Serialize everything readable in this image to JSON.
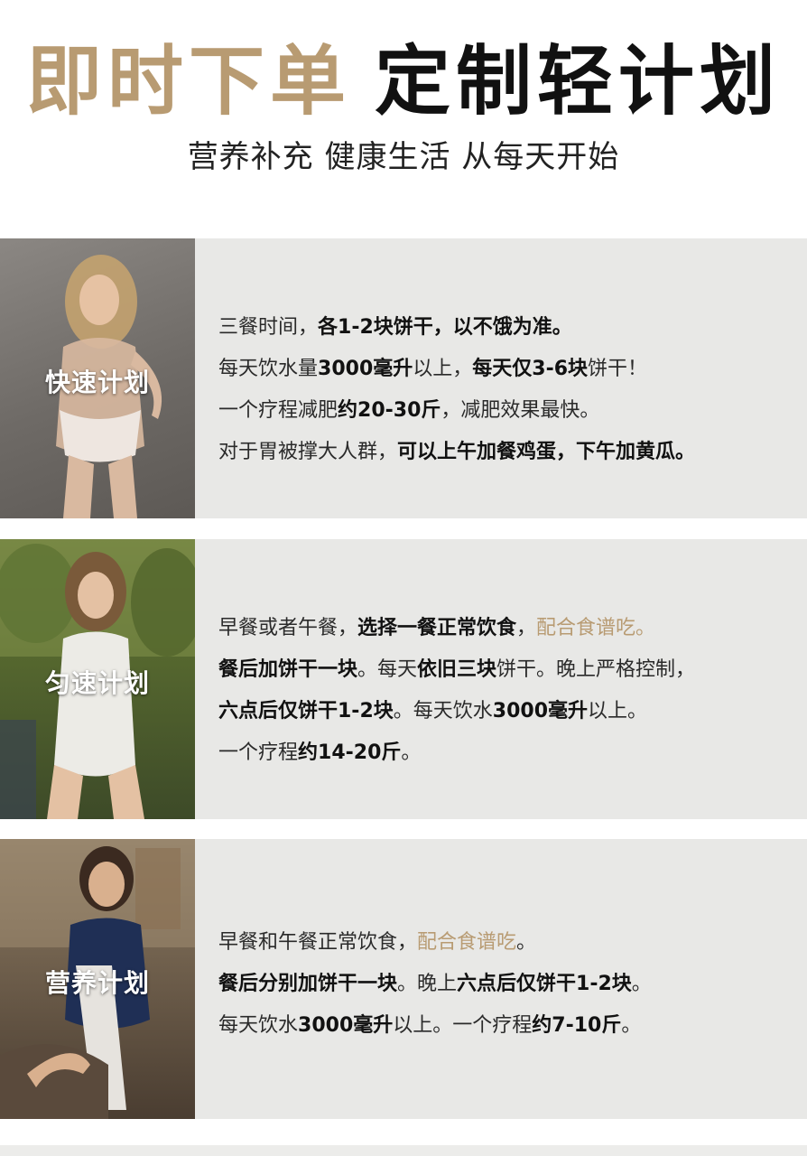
{
  "header": {
    "title_gold": "即时下单",
    "title_black": "定制轻计划",
    "subtitle": "营养补充 健康生活 从每天开始"
  },
  "colors": {
    "accent": "#b89b72",
    "panel": "#e8e8e6",
    "text": "#2a2a2a"
  },
  "plans": [
    {
      "label": "快速计划",
      "lines": [
        [
          {
            "t": "三餐时间，"
          },
          {
            "t": "各1-2块饼干，以不饿为准。",
            "b": true
          }
        ],
        [
          {
            "t": "每天饮水量"
          },
          {
            "t": "3000毫升",
            "b": true
          },
          {
            "t": "以上，"
          },
          {
            "t": "每天仅3-6块",
            "b": true
          },
          {
            "t": "饼干！"
          }
        ],
        [
          {
            "t": "一个疗程减肥"
          },
          {
            "t": "约20-30斤",
            "b": true
          },
          {
            "t": "，减肥效果最快。"
          }
        ],
        [
          {
            "t": "对于胃被撑大人群，"
          },
          {
            "t": "可以上午加餐鸡蛋，下午加黄瓜。",
            "b": true
          }
        ]
      ]
    },
    {
      "label": "匀速计划",
      "lines": [
        [
          {
            "t": "早餐或者午餐，"
          },
          {
            "t": "选择一餐正常饮食",
            "b": true
          },
          {
            "t": "，"
          },
          {
            "t": "配合食谱吃。",
            "a": true
          }
        ],
        [
          {
            "t": "餐后加饼干一块",
            "b": true
          },
          {
            "t": "。每天"
          },
          {
            "t": "依旧三块",
            "b": true
          },
          {
            "t": "饼干。晚上严格控制，"
          }
        ],
        [
          {
            "t": "六点后仅饼干1-2块",
            "b": true
          },
          {
            "t": "。每天饮水"
          },
          {
            "t": "3000毫升",
            "b": true
          },
          {
            "t": "以上。"
          }
        ],
        [
          {
            "t": "一个疗程"
          },
          {
            "t": "约14-20斤",
            "b": true
          },
          {
            "t": "。"
          }
        ]
      ]
    },
    {
      "label": "营养计划",
      "lines": [
        [
          {
            "t": "早餐和午餐正常饮食，"
          },
          {
            "t": "配合食谱吃",
            "a": true
          },
          {
            "t": "。"
          }
        ],
        [
          {
            "t": "餐后分别加饼干一块",
            "b": true
          },
          {
            "t": "。晚上"
          },
          {
            "t": "六点后仅饼干1-2块",
            "b": true
          },
          {
            "t": "。"
          }
        ],
        [
          {
            "t": "每天饮水"
          },
          {
            "t": "3000毫升",
            "b": true
          },
          {
            "t": "以上。一个疗程"
          },
          {
            "t": "约7-10斤",
            "b": true
          },
          {
            "t": "。"
          }
        ]
      ]
    }
  ]
}
